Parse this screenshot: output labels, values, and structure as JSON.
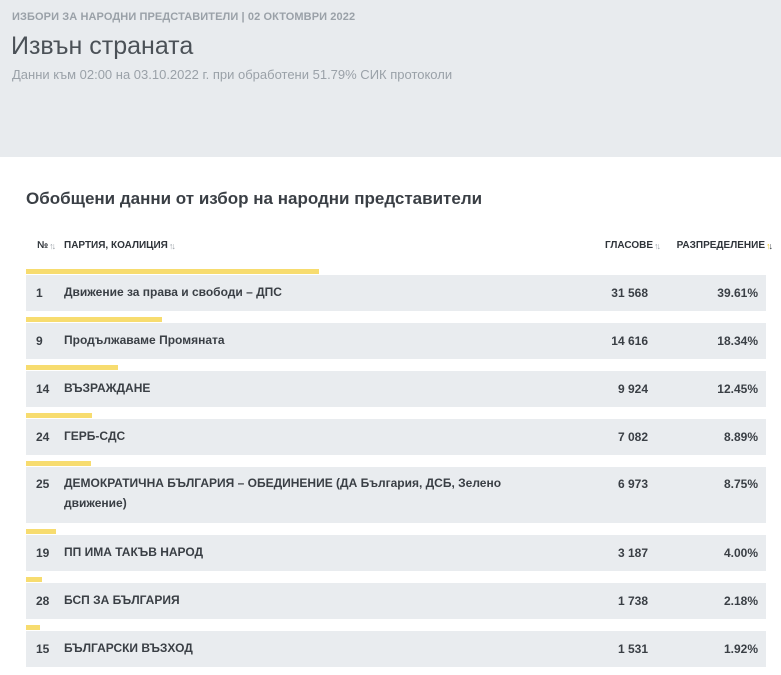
{
  "header": {
    "eyebrow": "ИЗБОРИ ЗА НАРОДНИ ПРЕДСТАВИТЕЛИ | 02 ОКТОМВРИ 2022",
    "title": "Извън страната",
    "subtitle": "Данни към 02:00 на 03.10.2022 г. при обработени 51.79% СИК протоколи"
  },
  "section": {
    "title": "Обобщени данни от избор на народни представители"
  },
  "table": {
    "columns": {
      "num": "№",
      "party": "ПАРТИЯ, КОАЛИЦИЯ",
      "votes": "ГЛАСОВЕ",
      "distribution": "РАЗПРЕДЕЛЕНИЕ"
    },
    "rows": [
      {
        "num": "1",
        "party": "Движение за права и свободи – ДПС",
        "votes": "31 568",
        "pct": "39.61%",
        "share": 39.61
      },
      {
        "num": "9",
        "party": "Продължаваме Промяната",
        "votes": "14 616",
        "pct": "18.34%",
        "share": 18.34
      },
      {
        "num": "14",
        "party": "ВЪЗРАЖДАНЕ",
        "votes": "9 924",
        "pct": "12.45%",
        "share": 12.45
      },
      {
        "num": "24",
        "party": "ГЕРБ-СДС",
        "votes": "7 082",
        "pct": "8.89%",
        "share": 8.89
      },
      {
        "num": "25",
        "party": "ДЕМОКРАТИЧНА БЪЛГАРИЯ – ОБЕДИНЕНИЕ (ДА България, ДСБ, Зелено движение)",
        "votes": "6 973",
        "pct": "8.75%",
        "share": 8.75
      },
      {
        "num": "19",
        "party": "ПП ИМА ТАКЪВ НАРОД",
        "votes": "3 187",
        "pct": "4.00%",
        "share": 4.0
      },
      {
        "num": "28",
        "party": "БСП ЗА БЪЛГАРИЯ",
        "votes": "1 738",
        "pct": "2.18%",
        "share": 2.18
      },
      {
        "num": "15",
        "party": "БЪЛГАРСКИ ВЪЗХОД",
        "votes": "1 531",
        "pct": "1.92%",
        "share": 1.92
      }
    ]
  },
  "colors": {
    "header_bg": "#e8ebee",
    "row_bg": "#e9ecef",
    "bar": "#f7dc6f",
    "sort_active": "#f0c419"
  }
}
